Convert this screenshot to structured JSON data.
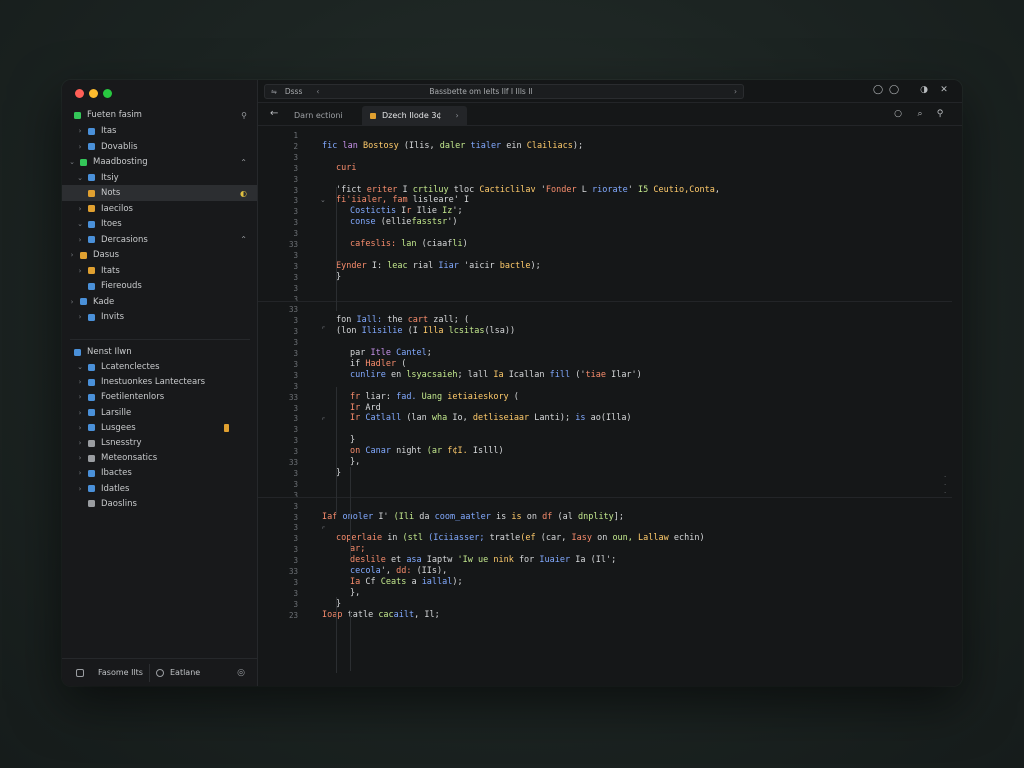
{
  "window": {
    "traffic_lights": [
      "#ff5f57",
      "#febc2e",
      "#28c840"
    ]
  },
  "sidebar": {
    "header": {
      "label": "Fueten fasim",
      "action": "⚲",
      "color": "#34c759"
    },
    "items": [
      {
        "label": "Itas",
        "color": "#4a90d9",
        "indent": 1,
        "chevron": "›"
      },
      {
        "label": "Dovablis",
        "color": "#4a90d9",
        "indent": 1,
        "chevron": "›"
      },
      {
        "label": "Maadbosting",
        "color": "#34c759",
        "indent": 0,
        "chevron": "⌄",
        "right": "⌃"
      },
      {
        "label": "Itsiy",
        "color": "#4a90d9",
        "indent": 1,
        "chevron": "⌄"
      },
      {
        "label": "Nots",
        "color": "#e0a030",
        "indent": 1,
        "chevron": "",
        "right": "◐",
        "selected": true
      },
      {
        "label": "Iaecilos",
        "color": "#e0a030",
        "indent": 1,
        "chevron": "›"
      },
      {
        "label": "Itoes",
        "color": "#4a90d9",
        "indent": 1,
        "chevron": "⌄"
      },
      {
        "label": "Dercasions",
        "color": "#4a90d9",
        "indent": 1,
        "chevron": "›",
        "right": "⌃"
      },
      {
        "label": "Dasus",
        "color": "#e0a030",
        "indent": 0,
        "chevron": "›"
      },
      {
        "label": "Itats",
        "color": "#e0a030",
        "indent": 1,
        "chevron": "›"
      },
      {
        "label": "Fiereouds",
        "color": "#4a90d9",
        "indent": 1,
        "chevron": ""
      },
      {
        "label": "Kade",
        "color": "#4a90d9",
        "indent": 0,
        "chevron": "›"
      },
      {
        "label": "Invits",
        "color": "#4a90d9",
        "indent": 1,
        "chevron": "›"
      }
    ],
    "section2": {
      "label": "Nenst Ilwn",
      "color": "#4a90d9"
    },
    "items2": [
      {
        "label": "Lcatenclectes",
        "color": "#4a90d9",
        "chevron": "⌄"
      },
      {
        "label": "Inestuonkes Lantectears",
        "color": "#4a90d9",
        "chevron": "›"
      },
      {
        "label": "Foetilentenlors",
        "color": "#4a90d9",
        "chevron": "›"
      },
      {
        "label": "Larsille",
        "color": "#4a90d9",
        "chevron": "›"
      },
      {
        "label": "Lusgees",
        "color": "#4a90d9",
        "chevron": "›",
        "badge": "#e0a030"
      },
      {
        "label": "Lsnesstry",
        "color": "#9a9da1",
        "chevron": "›"
      },
      {
        "label": "Meteonsatics",
        "color": "#9a9da1",
        "chevron": "›"
      },
      {
        "label": "Ibactes",
        "color": "#4a90d9",
        "chevron": "›"
      },
      {
        "label": "Idatles",
        "color": "#4a90d9",
        "chevron": "›"
      },
      {
        "label": "Daoslins",
        "color": "#9a9da1",
        "chevron": ""
      }
    ],
    "footer": {
      "button1": "Fasome Ilts",
      "button2": "Eatlane",
      "icon": "◎"
    }
  },
  "topbar": {
    "back": "⇋",
    "address_left": "Dsss",
    "address_chevron": "‹",
    "address_text": "Bassbette om Ielts Ilf I Ills Il",
    "address_dropdown": "›",
    "right_icons": [
      "◯",
      "◯",
      "◑",
      "✕"
    ]
  },
  "tabs": {
    "back": "←",
    "items": [
      {
        "label": "Darn ectioni",
        "active": false
      },
      {
        "label": "Dzech Ilode 3¢",
        "active": true,
        "close": "›"
      }
    ],
    "right_icons": [
      "○",
      "⌕",
      "⚲"
    ]
  },
  "editor": {
    "accent": "#c792ea",
    "line_numbers": [
      "1",
      "2",
      "3",
      "3",
      "3",
      "3",
      "3",
      "3",
      "3",
      "3",
      "33",
      "3",
      "3",
      "3",
      "3",
      "3",
      "3",
      "3",
      "3",
      "3",
      "33",
      "3",
      "3",
      "3",
      "3",
      "3",
      "3",
      "3",
      "3",
      "3",
      "33",
      "3",
      "3",
      "3",
      "3",
      "3",
      "3",
      "3",
      "3",
      "3",
      "33",
      "3",
      "3",
      "3",
      "3",
      "3",
      "3",
      "3",
      "3",
      "3",
      "23"
    ],
    "lines": [
      {
        "ln": "1",
        "indent": 0,
        "tokens": []
      },
      {
        "ln": "2",
        "indent": 0,
        "tokens": [
          [
            "f",
            "fic "
          ],
          [
            "k",
            "lan "
          ],
          [
            "y",
            "Bostosy "
          ],
          [
            "t",
            "(Ilis, "
          ],
          [
            "s",
            "daler"
          ],
          [
            "t",
            " "
          ],
          [
            "f",
            "tialer "
          ],
          [
            "t",
            "ein "
          ],
          [
            "y",
            "Clailiacs"
          ],
          [
            "t",
            ");"
          ]
        ]
      },
      {
        "ln": "3",
        "indent": 0,
        "tokens": []
      },
      {
        "ln": "3",
        "indent": 1,
        "tokens": [
          [
            "o",
            "curi"
          ]
        ]
      },
      {
        "ln": "3",
        "indent": 0,
        "tokens": []
      },
      {
        "ln": "3",
        "indent": 1,
        "tokens": [
          [
            "t",
            "'fict "
          ],
          [
            "o",
            "eriter"
          ],
          [
            "t",
            " I "
          ],
          [
            "s",
            "crtiluy "
          ],
          [
            "t",
            "tloc "
          ],
          [
            "y",
            "Cacticlilav "
          ],
          [
            "t",
            "'"
          ],
          [
            "o",
            "Fonder"
          ],
          [
            "t",
            " L "
          ],
          [
            "f",
            "riorate"
          ],
          [
            "t",
            "' "
          ],
          [
            "s",
            "I5 "
          ],
          [
            "y",
            "Ceutio,Conta"
          ],
          [
            "t",
            ","
          ]
        ]
      },
      {
        "ln": "3",
        "indent": 1,
        "tokens": [
          [
            "o",
            "fi'iialer,"
          ],
          [
            "t",
            " "
          ],
          [
            "o",
            "fam "
          ],
          [
            "t",
            "lisleare"
          ],
          [
            "t",
            "' I"
          ]
        ]
      },
      {
        "ln": "3",
        "indent": 2,
        "tokens": [
          [
            "f",
            "Costictis"
          ],
          [
            "t",
            " I"
          ],
          [
            "o",
            "r "
          ],
          [
            "t",
            "Ilie "
          ],
          [
            "s",
            "Iz"
          ],
          [
            "t",
            "';"
          ]
        ]
      },
      {
        "ln": "3",
        "indent": 2,
        "tokens": [
          [
            "f",
            "conse "
          ],
          [
            "t",
            "(ellie"
          ],
          [
            "s",
            "fasstsr"
          ],
          [
            "t",
            "')"
          ]
        ]
      },
      {
        "ln": "3",
        "indent": 0,
        "tokens": []
      },
      {
        "ln": "33",
        "indent": 2,
        "tokens": [
          [
            "o",
            "cafeslis: "
          ],
          [
            "s",
            "lan "
          ],
          [
            "t",
            "(ciaaf"
          ],
          [
            "s",
            "li"
          ],
          [
            "t",
            ")"
          ]
        ]
      },
      {
        "ln": "3",
        "indent": 0,
        "tokens": []
      },
      {
        "ln": "3",
        "indent": 1,
        "tokens": [
          [
            "o",
            "Eynder "
          ],
          [
            "t",
            "I: "
          ],
          [
            "s",
            "leac "
          ],
          [
            "t",
            "rial "
          ],
          [
            "f",
            "Iiar "
          ],
          [
            "t",
            "'aicir "
          ],
          [
            "y",
            "bactle"
          ],
          [
            "t",
            ");"
          ]
        ]
      },
      {
        "ln": "3",
        "indent": 1,
        "tokens": [
          [
            "t",
            "}"
          ]
        ]
      },
      {
        "ln": "3",
        "indent": 0,
        "tokens": []
      },
      {
        "ln": "3",
        "indent": 0,
        "sep": true,
        "tokens": []
      },
      {
        "ln": "33",
        "indent": 0,
        "tokens": []
      },
      {
        "ln": "3",
        "indent": 1,
        "tokens": [
          [
            "t",
            "fon "
          ],
          [
            "f",
            "Iall: "
          ],
          [
            "t",
            "the "
          ],
          [
            "o",
            "cart "
          ],
          [
            "t",
            "zall; ("
          ]
        ]
      },
      {
        "ln": "3",
        "indent": 1,
        "tokens": [
          [
            "t",
            "(lon "
          ],
          [
            "f",
            "Ilisilie "
          ],
          [
            "t",
            "(I "
          ],
          [
            "y",
            "Illa "
          ],
          [
            "s",
            "lcsitas"
          ],
          [
            "t",
            "(lsa))"
          ]
        ]
      },
      {
        "ln": "3",
        "indent": 0,
        "tokens": []
      },
      {
        "ln": "3",
        "indent": 2,
        "tokens": [
          [
            "t",
            "par "
          ],
          [
            "k",
            "Itle "
          ],
          [
            "f",
            "Cantel"
          ],
          [
            "t",
            ";"
          ]
        ]
      },
      {
        "ln": "3",
        "indent": 2,
        "tokens": [
          [
            "t",
            "if "
          ],
          [
            "o",
            "Hadler"
          ],
          [
            "t",
            " ("
          ]
        ]
      },
      {
        "ln": "3",
        "indent": 2,
        "tokens": [
          [
            "f",
            "cunlire "
          ],
          [
            "t",
            "en "
          ],
          [
            "s",
            "lsyacsaieh"
          ],
          [
            "t",
            "; lall "
          ],
          [
            "y",
            "Ia "
          ],
          [
            "t",
            "Icallan "
          ],
          [
            "f",
            "fill "
          ],
          [
            "t",
            "('"
          ],
          [
            "o",
            "tiae "
          ],
          [
            "t",
            "Ilar')"
          ]
        ]
      },
      {
        "ln": "3",
        "indent": 0,
        "tokens": []
      },
      {
        "ln": "33",
        "indent": 2,
        "tokens": [
          [
            "o",
            "fr "
          ],
          [
            "t",
            "liar: "
          ],
          [
            "f",
            "fad. "
          ],
          [
            "s",
            "Uang "
          ],
          [
            "y",
            "ietiaieskory "
          ],
          [
            "t",
            "("
          ]
        ]
      },
      {
        "ln": "3",
        "indent": 2,
        "tokens": [
          [
            "o",
            "Ir "
          ],
          [
            "t",
            "Ard"
          ]
        ]
      },
      {
        "ln": "3",
        "indent": 2,
        "tokens": [
          [
            "o",
            "Ir "
          ],
          [
            "f",
            "Catlall "
          ],
          [
            "t",
            "(lan "
          ],
          [
            "s",
            "wha "
          ],
          [
            "t",
            "Io, "
          ],
          [
            "y",
            "detliseiaar "
          ],
          [
            "t",
            "Lanti); "
          ],
          [
            "f",
            "is "
          ],
          [
            "t",
            "ao(Illa)"
          ]
        ]
      },
      {
        "ln": "3",
        "indent": 0,
        "tokens": []
      },
      {
        "ln": "3",
        "indent": 2,
        "tokens": [
          [
            "t",
            "}"
          ]
        ]
      },
      {
        "ln": "3",
        "indent": 2,
        "tokens": [
          [
            "o",
            "on "
          ],
          [
            "f",
            "Canar "
          ],
          [
            "t",
            "night "
          ],
          [
            "s",
            "(ar "
          ],
          [
            "y",
            "f¢I. "
          ],
          [
            "t",
            "Islll)"
          ]
        ]
      },
      {
        "ln": "33",
        "indent": 2,
        "tokens": [
          [
            "t",
            "},"
          ]
        ]
      },
      {
        "ln": "3",
        "indent": 1,
        "tokens": [
          [
            "t",
            "}"
          ]
        ]
      },
      {
        "ln": "3",
        "indent": 0,
        "tokens": []
      },
      {
        "ln": "3",
        "indent": 0,
        "sep": true,
        "tokens": []
      },
      {
        "ln": "3",
        "indent": 0,
        "tokens": []
      },
      {
        "ln": "3",
        "indent": 0,
        "tokens": [
          [
            "o",
            "Iaf "
          ],
          [
            "f",
            "onoler "
          ],
          [
            "t",
            "I' "
          ],
          [
            "s",
            "(Ili "
          ],
          [
            "t",
            "da "
          ],
          [
            "f",
            "coom_aatler "
          ],
          [
            "t",
            "is "
          ],
          [
            "y",
            "is "
          ],
          [
            "t",
            "on "
          ],
          [
            "o",
            "df "
          ],
          [
            "t",
            "(al "
          ],
          [
            "s",
            "dnplity"
          ],
          [
            "t",
            "];"
          ]
        ]
      },
      {
        "ln": "3",
        "indent": 0,
        "tokens": []
      },
      {
        "ln": "3",
        "indent": 1,
        "tokens": [
          [
            "o",
            "coperlaie "
          ],
          [
            "t",
            "in "
          ],
          [
            "s",
            "(stl "
          ],
          [
            "f",
            "(Iciiasser; "
          ],
          [
            "t",
            "tratle"
          ],
          [
            "y",
            "(ef "
          ],
          [
            "t",
            "(car, "
          ],
          [
            "o",
            "Iasy "
          ],
          [
            "t",
            "on "
          ],
          [
            "s",
            "oun, "
          ],
          [
            "y",
            "Lallaw "
          ],
          [
            "t",
            "echin)"
          ]
        ]
      },
      {
        "ln": "3",
        "indent": 2,
        "tokens": [
          [
            "o",
            "ar;"
          ]
        ]
      },
      {
        "ln": "3",
        "indent": 2,
        "tokens": [
          [
            "o",
            "deslile "
          ],
          [
            "t",
            "et "
          ],
          [
            "f",
            "asa "
          ],
          [
            "t",
            "Iaptw "
          ],
          [
            "s",
            "'Iw ue "
          ],
          [
            "y",
            "nink "
          ],
          [
            "t",
            "for "
          ],
          [
            "f",
            "Iuaier "
          ],
          [
            "t",
            "Ia (Il';"
          ]
        ]
      },
      {
        "ln": "33",
        "indent": 2,
        "tokens": [
          [
            "f",
            "cecola"
          ],
          [
            "t",
            "', "
          ],
          [
            "o",
            "dd: "
          ],
          [
            "t",
            "(IIs),"
          ]
        ]
      },
      {
        "ln": "3",
        "indent": 2,
        "tokens": [
          [
            "o",
            "Ia "
          ],
          [
            "t",
            "Cf "
          ],
          [
            "s",
            "Ceats "
          ],
          [
            "t",
            "a "
          ],
          [
            "f",
            "iallal"
          ],
          [
            "t",
            ");"
          ]
        ]
      },
      {
        "ln": "3",
        "indent": 2,
        "tokens": [
          [
            "t",
            "},"
          ]
        ]
      },
      {
        "ln": "3",
        "indent": 1,
        "tokens": [
          [
            "t",
            "}"
          ]
        ]
      },
      {
        "ln": "23",
        "indent": 0,
        "tokens": [
          [
            "o",
            "Ioap "
          ],
          [
            "t",
            "tatle "
          ],
          [
            "s",
            "cac"
          ],
          [
            "f",
            "ailt"
          ],
          [
            "t",
            ", Il;"
          ]
        ]
      }
    ]
  }
}
